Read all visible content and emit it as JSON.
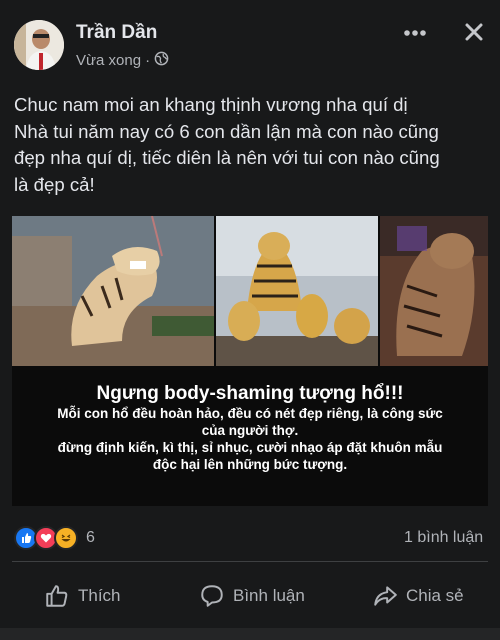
{
  "post": {
    "author": "Trần Dần",
    "time": "Vừa xong",
    "privacy_icon": "globe-icon",
    "text_lines": [
      "Chuc nam moi an khang thịnh vương nha quí dị",
      "Nhà tui năm nay có 6 con dần lận mà con nào cũng",
      "đẹp nha quí dị, tiếc diên là nên với tui con nào cũng",
      "là đẹp cả!"
    ]
  },
  "media": {
    "caption_title": "Ngưng body-shaming tượng hổ!!!",
    "caption_lines": [
      "Mỗi con hổ đều hoàn hảo, đều có nét đẹp riêng, là công sức",
      "của người thợ.",
      "đừng định kiến, kì thị, sỉ nhục, cười nhạo áp đặt khuôn mẫu",
      "độc hại lên những bức tượng."
    ]
  },
  "stats": {
    "reaction_icons": [
      "like-icon",
      "love-icon",
      "haha-icon"
    ],
    "reaction_count": "6",
    "comments": "1 bình luận"
  },
  "actions": {
    "like": "Thích",
    "comment": "Bình luận",
    "share": "Chia sẻ"
  },
  "colors": {
    "background": "#18191a",
    "text": "#e4e6eb",
    "secondary": "#b0b3b8",
    "like_blue": "#1877f2",
    "love_red": "#f33e58",
    "haha_yellow": "#f7b125"
  }
}
